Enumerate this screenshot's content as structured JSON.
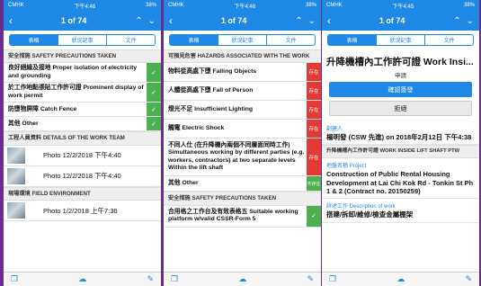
{
  "status": {
    "carrier": "CMHK",
    "time1": "下午4:46",
    "time2": "下午4:46",
    "time3": "下午4:45",
    "battery": "38%"
  },
  "nav": {
    "title": "1 of 74"
  },
  "tabs": [
    "表格",
    "狀況記事",
    "文件"
  ],
  "phone1": {
    "section1": "安全措施 SAFETY PRECAUTIONS TAKEN",
    "rows": [
      "良好絕緣及接地 Proper isolation of electricity and grounding",
      "於工作地點張貼工作許可證 Prominent display of work permit",
      "防墮物屏障 Catch Fence",
      "其他 Other"
    ],
    "section2": "工程人員資料 DETAILS OF THE WORK TEAM",
    "photos1": [
      "Photo 12/2/2018 下午4:40",
      "Photo 12/2/2018 下午4:40"
    ],
    "section3": "現場環境 FIELD ENVIRONMENT",
    "photos2": [
      "Photo 1/2/2018 上午7:36"
    ]
  },
  "phone2": {
    "section1": "可預見危害 HAZARDS ASSOCIATED WITH THE WORK",
    "rows": [
      "物料從高處下墮 Falling Objects",
      "人體從高處下墮 Fall of Person",
      "燈光不足 Insufficient Lighting",
      "觸電 Electric Shock",
      "不同人仕 (在升降機內兩個不同層面同時工作) Simultaneous working by different parties (e.g. workers, contractors) at two separate levels Within the lift shaft",
      "其他 Other"
    ],
    "badges": [
      "存在",
      "存在",
      "存在",
      "存在",
      "存在",
      "不存在"
    ],
    "section2": "安全措施 SAFETY PRECAUTIONS TAKEN",
    "rows2": [
      "合用格之工作台及有效表格五 Suitable working platform w/valid CSSR-Form 5"
    ]
  },
  "phone3": {
    "title": "升降機槽內工作許可證 Work Insi...",
    "subtitle": "申請",
    "confirm": "確認簽發",
    "reject": "拒絕",
    "fields": [
      {
        "label": "創建人",
        "value": "楊明發 (CSW 先進) on 2018年2月12日 下午4:38"
      },
      {
        "label": "升降機槽內工作許可證 WORK INSIDE LIFT SHAFT PTW",
        "value": ""
      },
      {
        "label": "地盤名稱 Project",
        "value": "Construction of Public Rental Housing Development at Lai Chi Kok Rd - Tonkin St Ph 1 & 2 (Contract no. 20150259)"
      },
      {
        "label": "詳述工作 Description of work",
        "value": "搭建/拆卸/維修/檢查金屬棚架"
      }
    ]
  },
  "colors": {
    "accent": "#1e88e5",
    "ok": "#4caf50",
    "bad": "#e53935",
    "background": "#6b2d8c"
  }
}
